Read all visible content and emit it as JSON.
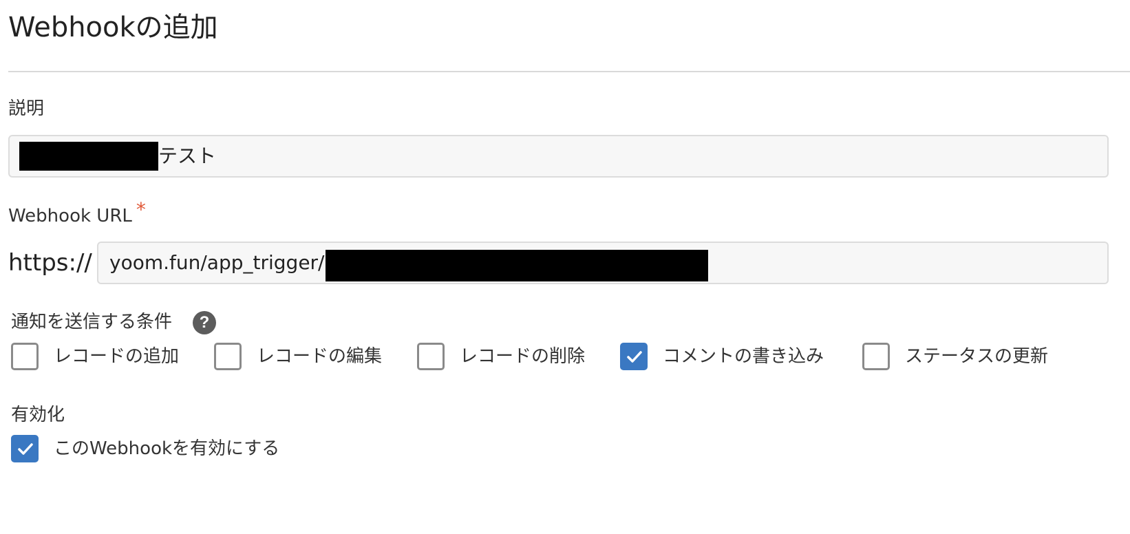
{
  "form": {
    "title": "Webhookの追加",
    "description": {
      "label": "説明",
      "value_visible": "テスト"
    },
    "url": {
      "label": "Webhook URL",
      "required_mark": "*",
      "prefix": "https://",
      "value_visible": "yoom.fun/app_trigger/"
    },
    "conditions": {
      "label": "通知を送信する条件",
      "help_icon": "question-circle-icon",
      "options": [
        {
          "label": "レコードの追加",
          "checked": false
        },
        {
          "label": "レコードの編集",
          "checked": false
        },
        {
          "label": "レコードの削除",
          "checked": false
        },
        {
          "label": "コメントの書き込み",
          "checked": true
        },
        {
          "label": "ステータスの更新",
          "checked": false
        }
      ]
    },
    "enable": {
      "label": "有効化",
      "checkbox_label": "このWebhookを有効にする",
      "checked": true
    }
  },
  "colors": {
    "accent": "#3a78c2",
    "required": "#e05a3a",
    "checkbox_border": "#8a8a8a",
    "input_background": "#f7f7f7",
    "divider": "#d9d9d9"
  }
}
